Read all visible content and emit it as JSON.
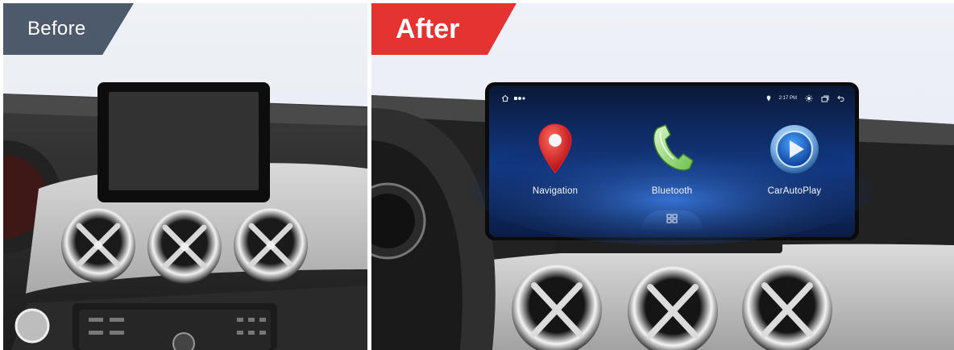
{
  "labels": {
    "before": "Before",
    "after": "After"
  },
  "screen": {
    "time": "2:17 PM",
    "apps": [
      {
        "label": "Navigation",
        "icon": "navigation-pin-icon"
      },
      {
        "label": "Bluetooth",
        "icon": "phone-handset-icon"
      },
      {
        "label": "CarAutoPlay",
        "icon": "carautoplay-icon"
      }
    ],
    "app_drawer_icon": "app-grid-icon"
  },
  "colors": {
    "before_tag": "#4c5a6c",
    "after_tag": "#e53331",
    "screen_blue": "#1a55b8"
  }
}
